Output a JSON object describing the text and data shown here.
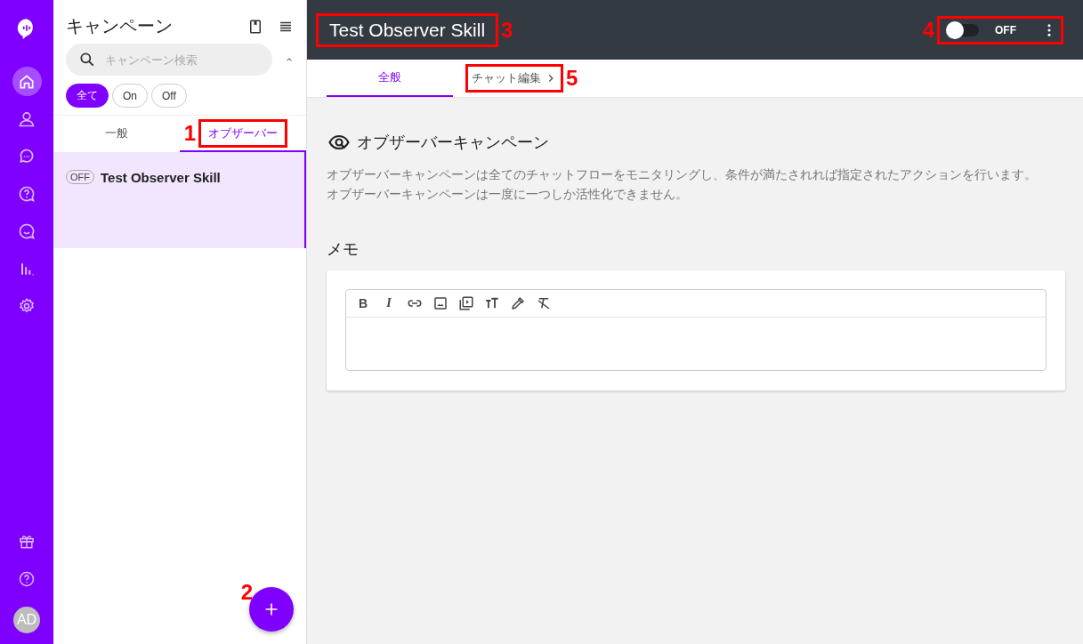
{
  "rail": {
    "items": [
      {
        "selected": true
      },
      {
        "selected": false
      },
      {
        "selected": false
      },
      {
        "selected": false
      },
      {
        "selected": false
      },
      {
        "selected": false
      },
      {
        "selected": false
      }
    ],
    "avatar": "AD"
  },
  "panel": {
    "title": "キャンペーン",
    "search": {
      "placeholder": "キャンペーン検索"
    },
    "filters": [
      {
        "label": "全て",
        "selected": true
      },
      {
        "label": "On",
        "selected": false
      },
      {
        "label": "Off",
        "selected": false
      }
    ],
    "tabs": [
      {
        "label": "一般",
        "selected": false
      },
      {
        "label": "オブザーバー",
        "selected": true,
        "callout": "1"
      }
    ],
    "campaigns": [
      {
        "status": "OFF",
        "name": "Test Observer Skill",
        "selected": true
      }
    ],
    "add_button": {
      "callout": "2"
    }
  },
  "header": {
    "title": "Test Observer Skill",
    "title_callout": "3",
    "toggle": {
      "on": false,
      "label": "OFF"
    },
    "controls_callout": "4"
  },
  "tabs": [
    {
      "label": "全般",
      "selected": true
    },
    {
      "label": "チャット編集",
      "selected": false,
      "callout": "5"
    }
  ],
  "section": {
    "title": "オブザーバーキャンペーン",
    "description": [
      "オブザーバーキャンペーンは全てのチャットフローをモニタリングし、条件が満たされれば指定されたアクションを行います。",
      "オブザーバーキャンペーンは一度に一つしか活性化できません。"
    ]
  },
  "memo": {
    "title": "メモ",
    "toolbar": [
      {
        "kind": "bold",
        "label": "B"
      },
      {
        "kind": "italic",
        "label": "I"
      }
    ]
  }
}
